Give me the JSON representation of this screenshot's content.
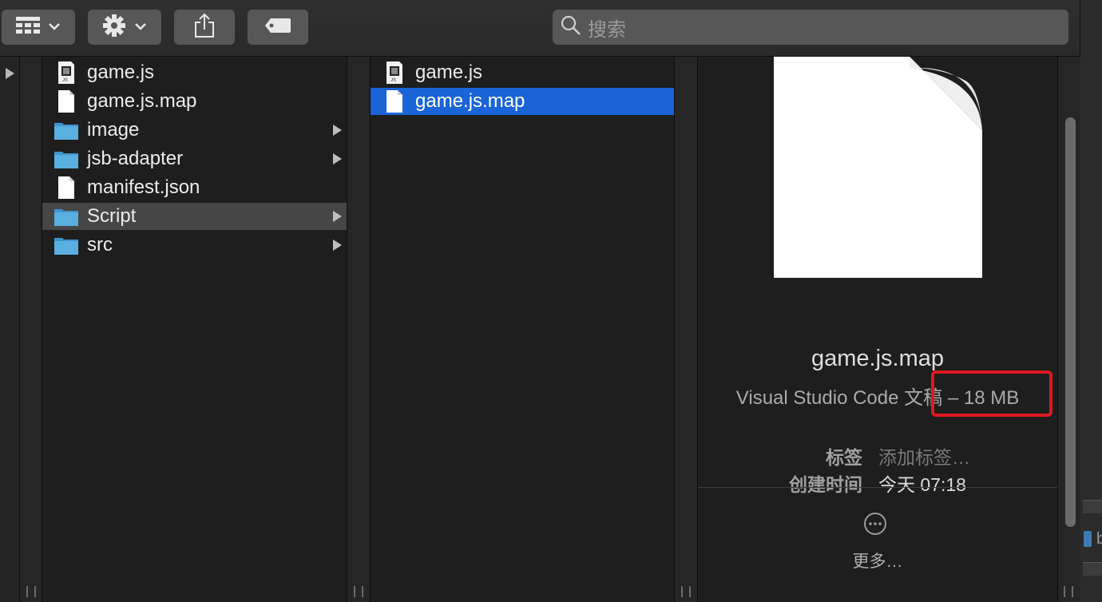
{
  "toolbar": {
    "view_button": {
      "icon": "grid-view-icon"
    },
    "action_button": {
      "icon": "gear-icon"
    },
    "share_button": {
      "icon": "share-icon"
    },
    "tag_button": {
      "icon": "tag-icon"
    },
    "search": {
      "placeholder": "搜索",
      "icon": "magnifier-icon"
    }
  },
  "column1": {
    "items": [
      {
        "label": "game.js",
        "type": "js-file",
        "expandable": false,
        "selected": false
      },
      {
        "label": "game.js.map",
        "type": "file",
        "expandable": false,
        "selected": false
      },
      {
        "label": "image",
        "type": "folder",
        "expandable": true,
        "selected": false
      },
      {
        "label": "jsb-adapter",
        "type": "folder",
        "expandable": true,
        "selected": false
      },
      {
        "label": "manifest.json",
        "type": "file",
        "expandable": false,
        "selected": false
      },
      {
        "label": "Script",
        "type": "folder",
        "expandable": true,
        "selected": true
      },
      {
        "label": "src",
        "type": "folder",
        "expandable": true,
        "selected": false
      }
    ]
  },
  "column2": {
    "items": [
      {
        "label": "game.js",
        "type": "js-file",
        "selected": false
      },
      {
        "label": "game.js.map",
        "type": "file",
        "selected": true
      }
    ]
  },
  "preview": {
    "file_name": "game.js.map",
    "kind_prefix": "Visual Studio Code 文稿",
    "size": "18 MB",
    "tags_label": "标签",
    "tags_placeholder": "添加标签…",
    "created_label": "创建时间",
    "created_value": "今天 07:18",
    "more_label": "更多…"
  },
  "right_strip": {
    "partial_text": "b"
  },
  "colors": {
    "selection_blue": "#1a64d8",
    "selection_gray": "#464646",
    "highlight_red": "#e0191f",
    "folder_blue": "#5aaee0"
  }
}
